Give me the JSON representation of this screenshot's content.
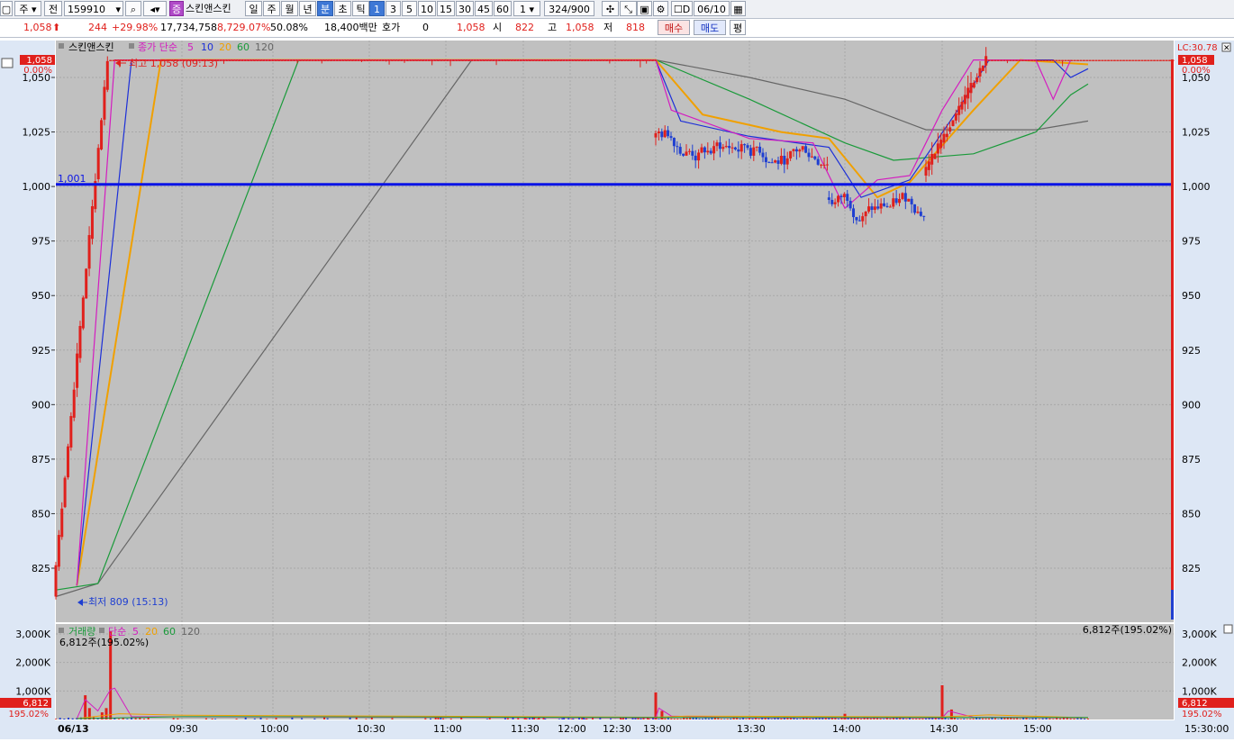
{
  "toolbar": {
    "market": "주",
    "prev": "전",
    "code": "159910",
    "name": "스킨앤스킨",
    "badge": "증",
    "periods": [
      "일",
      "주",
      "월",
      "년",
      "분",
      "초",
      "틱"
    ],
    "active_period": "분",
    "intervals": [
      "1",
      "3",
      "5",
      "10",
      "15",
      "30",
      "45",
      "60"
    ],
    "active_interval": "1",
    "step": "1",
    "count": "324",
    "count_total": "/900",
    "d_label": "D",
    "date": "06/10"
  },
  "info": {
    "price": "1,058",
    "change": "244",
    "change_pct": "+29.98%",
    "volume": "17,734,758",
    "vol_change_pct": "8,729.07%",
    "turnover_pct": "50.08%",
    "amount": "18,400백만",
    "quote_label": "호가",
    "quote_value": "0",
    "quote_price": "1,058",
    "open_label": "시",
    "open": "822",
    "high_label": "고",
    "high": "1,058",
    "low_label": "저",
    "low": "818",
    "buy": "매수",
    "sell": "매도",
    "avg": "평"
  },
  "price_panel": {
    "legend_name": "스킨앤스킨",
    "legend_ma_label": "종가 단순",
    "legend_ma_periods": [
      "5",
      "10",
      "20",
      "60",
      "120"
    ],
    "last_price_tag": "1,058",
    "last_pct_tag": "0.00%",
    "lc_label": "LC:30.78",
    "hline_label": "1,001",
    "high_note": "최고 1,058 (09:13)",
    "low_note": "최저 809 (15:13)"
  },
  "volume_panel": {
    "legend_name": "거래량",
    "legend_ma_label": "단순",
    "legend_ma_periods": [
      "5",
      "20",
      "60",
      "120"
    ],
    "sub_label": "6,812주(195.02%)",
    "right_label": "6,812주(195.02%)",
    "last_tag": "6,812",
    "last_pct_tag": "195.02%"
  },
  "x_axis": {
    "date": "06/13",
    "ticks": [
      "09:30",
      "10:00",
      "10:30",
      "11:00",
      "11:30",
      "12:00",
      "12:30",
      "13:00",
      "13:30",
      "14:00",
      "14:30",
      "15:00"
    ],
    "end_time": "15:30:00"
  },
  "colors": {
    "up": "#e0201c",
    "down": "#1f3fd1",
    "ma5": "#d41cc0",
    "ma10": "#1c2fd8",
    "ma20": "#f0a000",
    "ma60": "#1a9a3a",
    "ma120": "#666666",
    "hline": "#0a14e6",
    "panel_bg": "#c0c0c0"
  },
  "chart_data": [
    {
      "type": "candlestick",
      "title": "스킨앤스킨",
      "x_unit": "time",
      "y_ticks": [
        825,
        850,
        875,
        900,
        925,
        950,
        975,
        1000,
        1025,
        1050
      ],
      "ylim": [
        800,
        1058
      ],
      "high": {
        "price": 1058,
        "time": "09:13"
      },
      "low": {
        "price": 809,
        "time": "15:13"
      },
      "horizontal_line": 1001,
      "last_price": 1058,
      "ma_periods": [
        5,
        10,
        20,
        60,
        120
      ],
      "segments": [
        {
          "from": "09:00",
          "to": "09:13",
          "from_price": 812,
          "to_price": 1058
        },
        {
          "from": "09:13",
          "to": "13:00",
          "price": 1058
        },
        {
          "from": "13:00",
          "to": "13:55",
          "price_range": [
            1010,
            1035
          ]
        },
        {
          "from": "13:55",
          "to": "14:25",
          "price_range": [
            975,
            1015
          ]
        },
        {
          "from": "14:25",
          "to": "14:45",
          "from_price": 1005,
          "to_price": 1058
        },
        {
          "from": "14:45",
          "to": "15:30",
          "price": 1058
        }
      ],
      "ma_lines": [
        {
          "name": "5",
          "points": [
            [
              "09:05",
              817
            ],
            [
              "09:14",
              1058
            ],
            [
              "13:00",
              1058
            ],
            [
              "13:05",
              1035
            ],
            [
              "13:30",
              1022
            ],
            [
              "13:50",
              1020
            ],
            [
              "14:00",
              990
            ],
            [
              "14:10",
              1003
            ],
            [
              "14:20",
              1005
            ],
            [
              "14:30",
              1035
            ],
            [
              "14:40",
              1058
            ],
            [
              "15:00",
              1058
            ],
            [
              "15:05",
              1040
            ],
            [
              "15:10",
              1058
            ]
          ]
        },
        {
          "name": "10",
          "points": [
            [
              "09:05",
              817
            ],
            [
              "09:18",
              1058
            ],
            [
              "13:00",
              1058
            ],
            [
              "13:08",
              1030
            ],
            [
              "13:30",
              1023
            ],
            [
              "13:55",
              1018
            ],
            [
              "14:05",
              995
            ],
            [
              "14:20",
              1003
            ],
            [
              "14:35",
              1035
            ],
            [
              "14:45",
              1058
            ],
            [
              "15:05",
              1058
            ],
            [
              "15:10",
              1050
            ],
            [
              "15:15",
              1054
            ]
          ]
        },
        {
          "name": "20",
          "points": [
            [
              "09:05",
              817
            ],
            [
              "09:25",
              1058
            ],
            [
              "13:00",
              1058
            ],
            [
              "13:15",
              1033
            ],
            [
              "13:40",
              1025
            ],
            [
              "13:55",
              1022
            ],
            [
              "14:10",
              995
            ],
            [
              "14:20",
              1002
            ],
            [
              "14:40",
              1035
            ],
            [
              "14:55",
              1058
            ],
            [
              "15:15",
              1056
            ]
          ]
        },
        {
          "name": "60",
          "points": [
            [
              "09:00",
              815
            ],
            [
              "09:10",
              818
            ],
            [
              "10:08",
              1058
            ],
            [
              "13:00",
              1058
            ],
            [
              "13:30",
              1040
            ],
            [
              "14:00",
              1020
            ],
            [
              "14:15",
              1012
            ],
            [
              "14:40",
              1015
            ],
            [
              "15:00",
              1025
            ],
            [
              "15:10",
              1042
            ],
            [
              "15:15",
              1047
            ]
          ]
        },
        {
          "name": "120",
          "points": [
            [
              "09:00",
              812
            ],
            [
              "09:10",
              818
            ],
            [
              "11:10",
              1058
            ],
            [
              "13:00",
              1058
            ],
            [
              "13:30",
              1050
            ],
            [
              "14:00",
              1040
            ],
            [
              "14:25",
              1026
            ],
            [
              "15:00",
              1026
            ],
            [
              "15:15",
              1030
            ]
          ]
        }
      ]
    },
    {
      "type": "bar",
      "title": "거래량",
      "y_ticks": [
        "1,000K",
        "2,000K",
        "3,000K"
      ],
      "ylim": [
        0,
        3300000
      ],
      "peak": {
        "time": "09:13",
        "value": 3100000
      },
      "last_value": 6812,
      "last_pct": "195.02%",
      "notable_bars": [
        [
          "09:07",
          850000
        ],
        [
          "09:08",
          400000
        ],
        [
          "09:11",
          250000
        ],
        [
          "09:12",
          400000
        ],
        [
          "09:13",
          3100000
        ],
        [
          "13:00",
          950000
        ],
        [
          "13:02",
          300000
        ],
        [
          "14:00",
          200000
        ],
        [
          "14:30",
          1200000
        ],
        [
          "14:33",
          350000
        ]
      ]
    }
  ]
}
